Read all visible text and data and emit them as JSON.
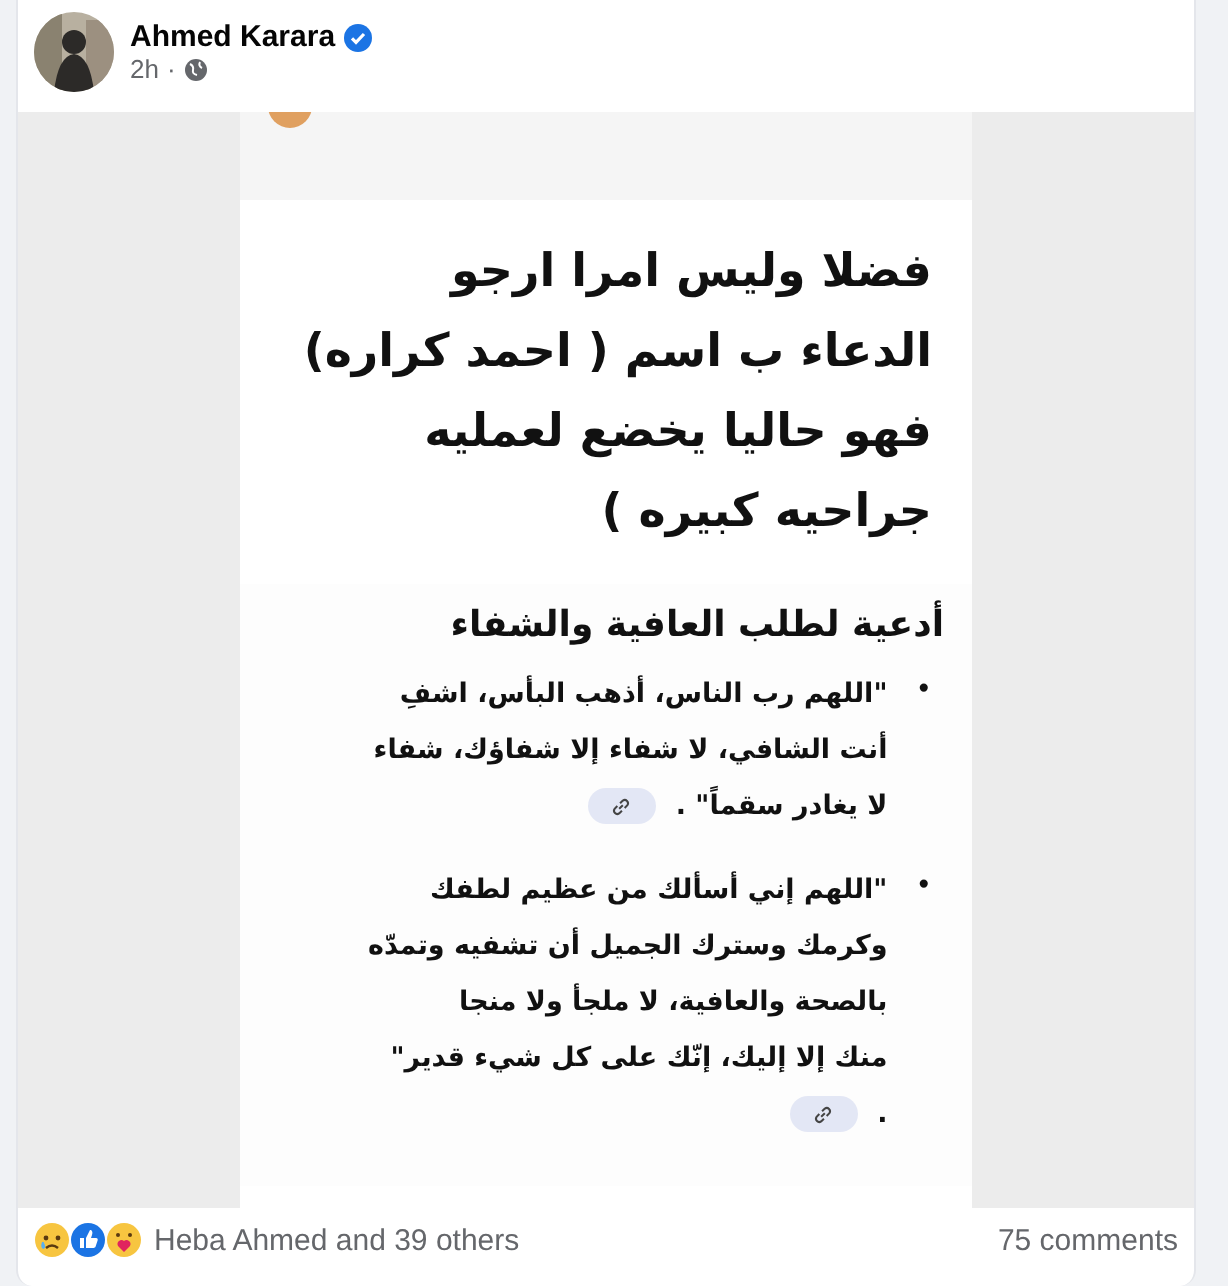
{
  "post": {
    "author": "Ahmed Karara",
    "verified": true,
    "time": "2h",
    "separator": "·"
  },
  "image": {
    "heading_lines": [
      "فضلا وليس امرا ارجو",
      "الدعاء ب اسم ( احمد كراره)",
      "فهو حاليا يخضع لعمليه",
      "جراحيه كبيره )"
    ],
    "section_title": "أدعية لطلب العافية والشفاء",
    "prayers": [
      {
        "bullet": "•",
        "lines": [
          "\"اللهم رب الناس، أذهب البأس، اشفِ",
          "أنت الشافي، لا شفاء إلا شفاؤك، شفاء",
          "لا يغادر سقماً\" ."
        ]
      },
      {
        "bullet": "•",
        "lines": [
          "\"اللهم إني أسألك من عظيم لطفك",
          "وكرمك وسترك الجميل أن تشفيه وتمدّه",
          "بالصحة والعافية، لا ملجأ ولا منجا",
          "منك إلا إليك، إنّك على كل شيء قدير\"",
          "."
        ]
      }
    ]
  },
  "footer": {
    "reactions": [
      {
        "kind": "sad"
      },
      {
        "kind": "like"
      },
      {
        "kind": "care"
      }
    ],
    "reactors": "Heba Ahmed and 39 others",
    "comments": "75 comments"
  }
}
